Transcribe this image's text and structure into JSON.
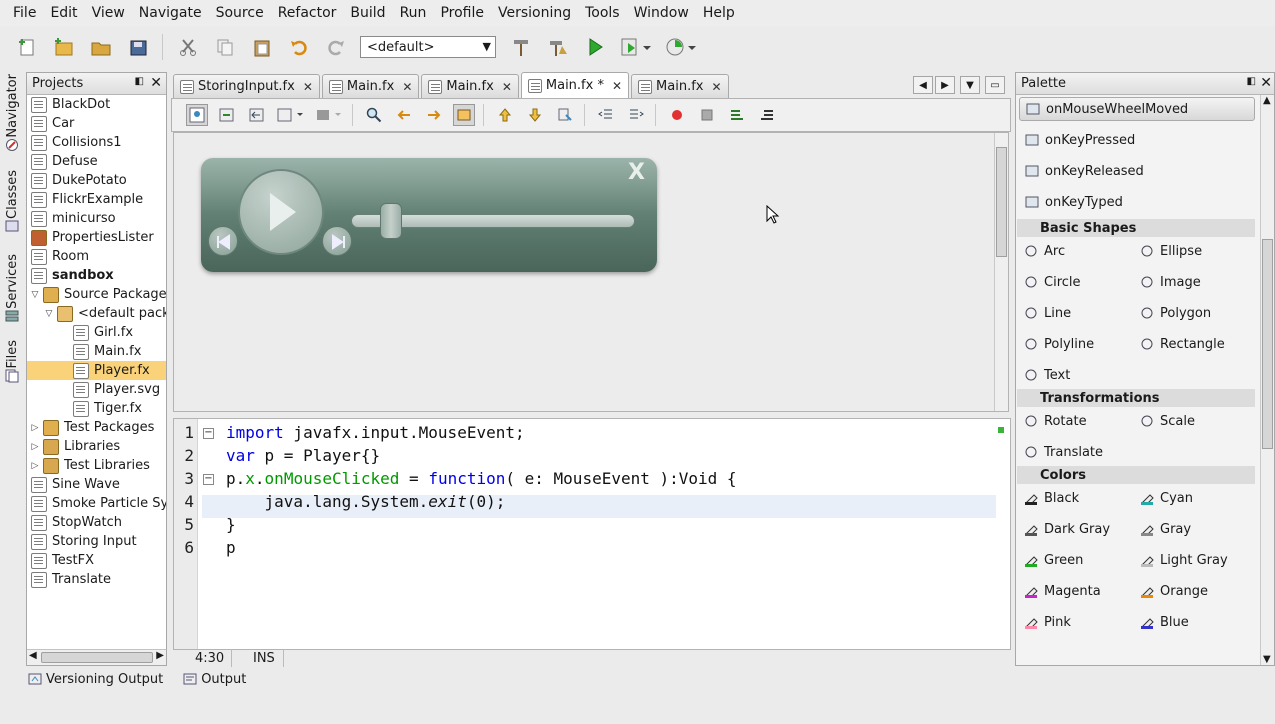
{
  "menu": [
    "File",
    "Edit",
    "View",
    "Navigate",
    "Source",
    "Refactor",
    "Build",
    "Run",
    "Profile",
    "Versioning",
    "Tools",
    "Window",
    "Help"
  ],
  "toolbar": {
    "config_value": "<default>"
  },
  "sidetabs": [
    "Navigator",
    "Classes",
    "Services",
    "Files"
  ],
  "projects": {
    "title": "Projects",
    "items": [
      {
        "label": "BlackDot",
        "level": 0,
        "icon": "project-icon"
      },
      {
        "label": "Car",
        "level": 0,
        "icon": "project-icon"
      },
      {
        "label": "Collisions1",
        "level": 0,
        "icon": "project-icon"
      },
      {
        "label": "Defuse",
        "level": 0,
        "icon": "project-icon"
      },
      {
        "label": "DukePotato",
        "level": 0,
        "icon": "project-icon"
      },
      {
        "label": "FlickrExample",
        "level": 0,
        "icon": "project-icon"
      },
      {
        "label": "minicurso",
        "level": 0,
        "icon": "project-icon"
      },
      {
        "label": "PropertiesLister",
        "level": 0,
        "icon": "coffee-icon"
      },
      {
        "label": "Room",
        "level": 0,
        "icon": "project-icon"
      },
      {
        "label": "sandbox",
        "level": 0,
        "icon": "project-icon",
        "bold": true
      },
      {
        "label": "Source Packages",
        "level": 1,
        "icon": "package-folder-icon",
        "expander": "▽"
      },
      {
        "label": "<default package>",
        "level": 2,
        "icon": "package-icon",
        "expander": "▽"
      },
      {
        "label": "Girl.fx",
        "level": 3,
        "icon": "file-icon"
      },
      {
        "label": "Main.fx",
        "level": 3,
        "icon": "file-icon"
      },
      {
        "label": "Player.fx",
        "level": 3,
        "icon": "file-icon",
        "selected": true
      },
      {
        "label": "Player.svg",
        "level": 3,
        "icon": "svg-file-icon"
      },
      {
        "label": "Tiger.fx",
        "level": 3,
        "icon": "file-icon"
      },
      {
        "label": "Test Packages",
        "level": 1,
        "icon": "package-folder-icon",
        "expander": "▷"
      },
      {
        "label": "Libraries",
        "level": 1,
        "icon": "library-icon",
        "expander": "▷"
      },
      {
        "label": "Test Libraries",
        "level": 1,
        "icon": "library-icon",
        "expander": "▷"
      },
      {
        "label": "Sine Wave",
        "level": 0,
        "icon": "project-icon"
      },
      {
        "label": "Smoke Particle System",
        "level": 0,
        "icon": "project-icon"
      },
      {
        "label": "StopWatch",
        "level": 0,
        "icon": "project-icon"
      },
      {
        "label": "Storing Input",
        "level": 0,
        "icon": "project-icon"
      },
      {
        "label": "TestFX",
        "level": 0,
        "icon": "project-icon"
      },
      {
        "label": "Translate",
        "level": 0,
        "icon": "project-icon"
      }
    ]
  },
  "editor_tabs": [
    {
      "label": "StoringInput.fx",
      "active": false
    },
    {
      "label": "Main.fx",
      "active": false
    },
    {
      "label": "Main.fx",
      "active": false
    },
    {
      "label": "Main.fx *",
      "active": true
    },
    {
      "label": "Main.fx",
      "active": false
    }
  ],
  "player": {
    "close_label": "X"
  },
  "code": {
    "line_numbers": [
      "1",
      "2",
      "3",
      "4",
      "5",
      "6"
    ],
    "lines": [
      [
        {
          "t": "import",
          "c": "kw"
        },
        {
          "t": " javafx.input.MouseEvent;",
          "c": ""
        }
      ],
      [
        {
          "t": "var",
          "c": "kw"
        },
        {
          "t": " p = Player{}",
          "c": ""
        }
      ],
      [
        {
          "t": "p.",
          "c": ""
        },
        {
          "t": "x",
          "c": "fn"
        },
        {
          "t": ".",
          "c": ""
        },
        {
          "t": "onMouseClicked",
          "c": "fn"
        },
        {
          "t": " = ",
          "c": ""
        },
        {
          "t": "function",
          "c": "kw"
        },
        {
          "t": "( e: MouseEvent ):Void {",
          "c": ""
        }
      ],
      [
        {
          "t": "    java.lang.System.",
          "c": ""
        },
        {
          "t": "exit",
          "c": "it"
        },
        {
          "t": "(0);",
          "c": ""
        }
      ],
      [
        {
          "t": "}",
          "c": ""
        }
      ],
      [
        {
          "t": "p",
          "c": ""
        }
      ]
    ]
  },
  "status": {
    "position": "4:30",
    "mode": "INS"
  },
  "palette": {
    "title": "Palette",
    "events": [
      "onMouseWheelMoved",
      "onKeyPressed",
      "onKeyReleased",
      "onKeyTyped"
    ],
    "categories": [
      {
        "name": "Basic Shapes",
        "items": [
          "Arc",
          "Ellipse",
          "Circle",
          "Image",
          "Line",
          "Polygon",
          "Polyline",
          "Rectangle",
          "Text"
        ]
      },
      {
        "name": "Transformations",
        "items": [
          "Rotate",
          "Scale",
          "Translate"
        ]
      },
      {
        "name": "Colors",
        "items": [
          "Black",
          "Cyan",
          "Dark Gray",
          "Gray",
          "Green",
          "Light Gray",
          "Magenta",
          "Orange",
          "Pink",
          "Blue"
        ]
      }
    ]
  },
  "bottom_tabs": [
    "Versioning Output",
    "Output"
  ]
}
